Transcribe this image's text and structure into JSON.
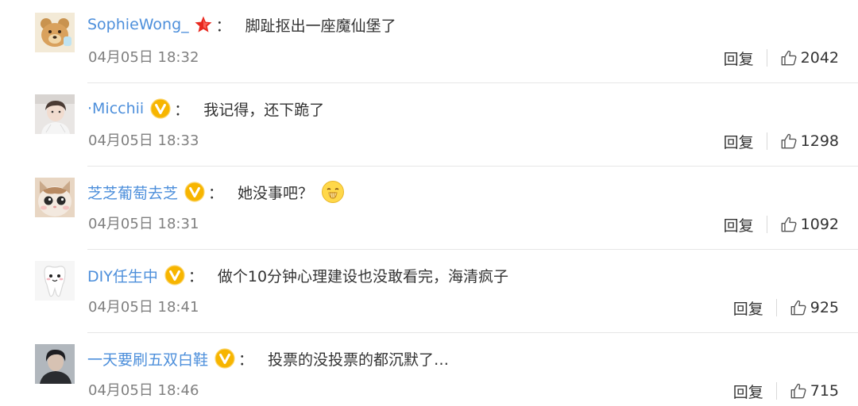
{
  "comments": [
    {
      "username": "SophieWong_",
      "badge_icon": "red-star-icon",
      "colon": "：",
      "text": "脚趾抠出一座魔仙堡了",
      "time": "04月05日 18:32",
      "reply_label": "回复",
      "like_count": "2042",
      "avatar": "bear-avatar"
    },
    {
      "username": "·Micchii",
      "badge_icon": "gold-v-badge-icon",
      "colon": "：",
      "text": "我记得，还下跪了",
      "time": "04月05日 18:33",
      "reply_label": "回复",
      "like_count": "1298",
      "avatar": "person-photo-avatar"
    },
    {
      "username": "芝芝葡萄去芝",
      "badge_icon": "gold-v-badge-icon",
      "colon": "：",
      "text": "她没事吧？",
      "emoji": "hush-face-emoji",
      "time": "04月05日 18:31",
      "reply_label": "回复",
      "like_count": "1092",
      "avatar": "cat-avatar"
    },
    {
      "username": "DIY任生中",
      "badge_icon": "gold-v-badge-icon",
      "colon": "：",
      "text": "做个10分钟心理建设也没敢看完，海清疯子",
      "time": "04月05日 18:41",
      "reply_label": "回复",
      "like_count": "925",
      "avatar": "tooth-avatar"
    },
    {
      "username": "一天要刷五双白鞋",
      "badge_icon": "gold-v-badge-icon",
      "colon": "：",
      "text": "投票的没投票的都沉默了…",
      "time": "04月05日 18:46",
      "reply_label": "回复",
      "like_count": "715",
      "avatar": "dark-photo-avatar"
    }
  ],
  "colors": {
    "username": "#4d8fdb",
    "text": "#333333",
    "time": "#808080",
    "badge_gold": "#f7b500",
    "star_red": "#e8281e",
    "divider": "#e6e6e6"
  }
}
